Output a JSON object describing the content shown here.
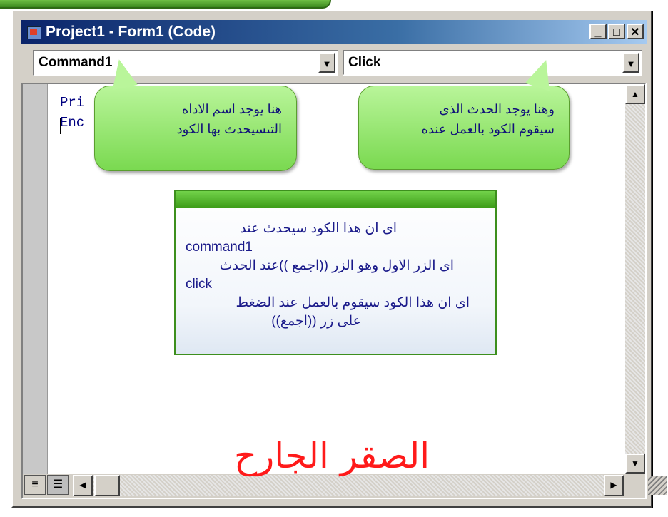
{
  "window": {
    "title": "Project1 - Form1 (Code)",
    "controls": {
      "minimize": "_",
      "maximize": "□",
      "close": "✕"
    }
  },
  "object_combo": {
    "value": "Command1"
  },
  "event_combo": {
    "value": "Click"
  },
  "code_lines": [
    "Pri           _Click()",
    "",
    "Enc"
  ],
  "callouts": {
    "object": {
      "line1": "هنا يوجد اسم الاداه",
      "line2": "التىسيحدث بها الكود"
    },
    "event": {
      "line1": "وهنا يوجد الحدث الذى",
      "line2": "سيقوم الكود بالعمل عنده"
    }
  },
  "note": {
    "lines": [
      "اى ان هذا الكود سيحدث عند",
      "command1",
      "اى الزر الاول وهو الزر ((اجمع ))عند الحدث",
      "click",
      "اى ان هذا الكود سيقوم بالعمل عند الضغط",
      "على زر ((اجمع))"
    ]
  },
  "signature": "الصقر الجارح",
  "colors": {
    "code_keyword": "#000080",
    "callout_green": "#7ad950",
    "signature_red": "#ff1a1a",
    "titlebar": "#0a246a"
  }
}
